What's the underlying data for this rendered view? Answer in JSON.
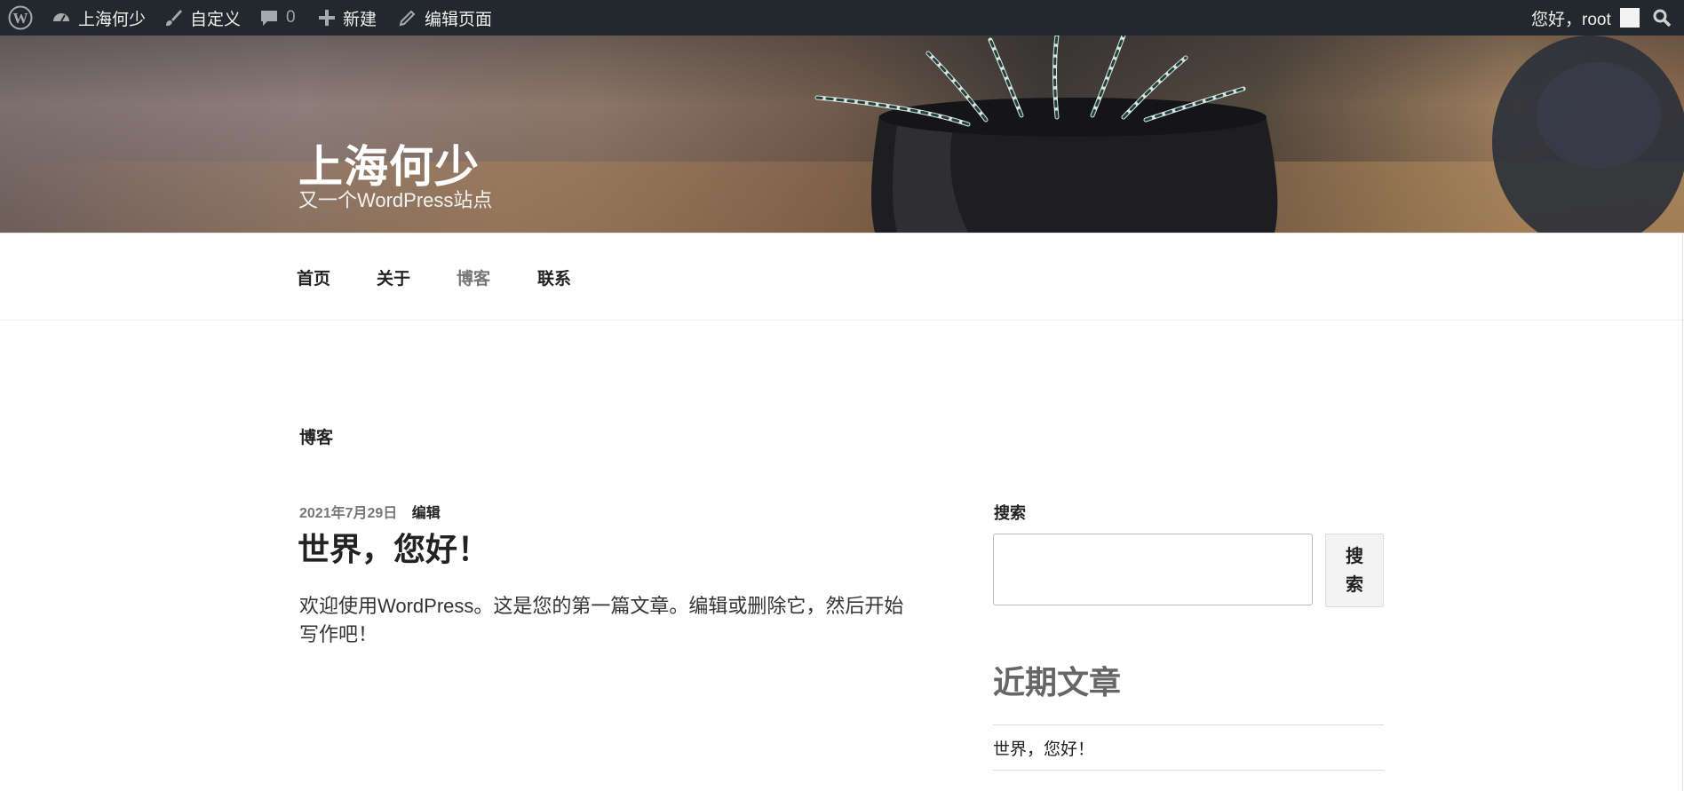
{
  "admin_bar": {
    "wp_logo_icon": "wordpress-logo-icon",
    "site_name": "上海何少",
    "customize": "自定义",
    "comments_count": "0",
    "new": "新建",
    "edit_page": "编辑页面",
    "greeting": "您好，root",
    "search_icon": "search-icon"
  },
  "header": {
    "site_title": "上海何少",
    "site_description": "又一个WordPress站点"
  },
  "nav": {
    "items": [
      {
        "label": "首页"
      },
      {
        "label": "关于"
      },
      {
        "label": "博客",
        "current": true
      },
      {
        "label": "联系"
      }
    ]
  },
  "main": {
    "page_heading": "博客",
    "post": {
      "date": "2021年7月29日",
      "edit": "编辑",
      "title": "世界，您好！",
      "excerpt": "欢迎使用WordPress。这是您的第一篇文章。编辑或删除它，然后开始写作吧！"
    }
  },
  "sidebar": {
    "search_label": "搜索",
    "search_button_line1": "搜",
    "search_button_line2": "索",
    "search_value": "",
    "recent_title": "近期文章",
    "recent_posts": [
      {
        "title": "世界，您好！"
      }
    ]
  }
}
